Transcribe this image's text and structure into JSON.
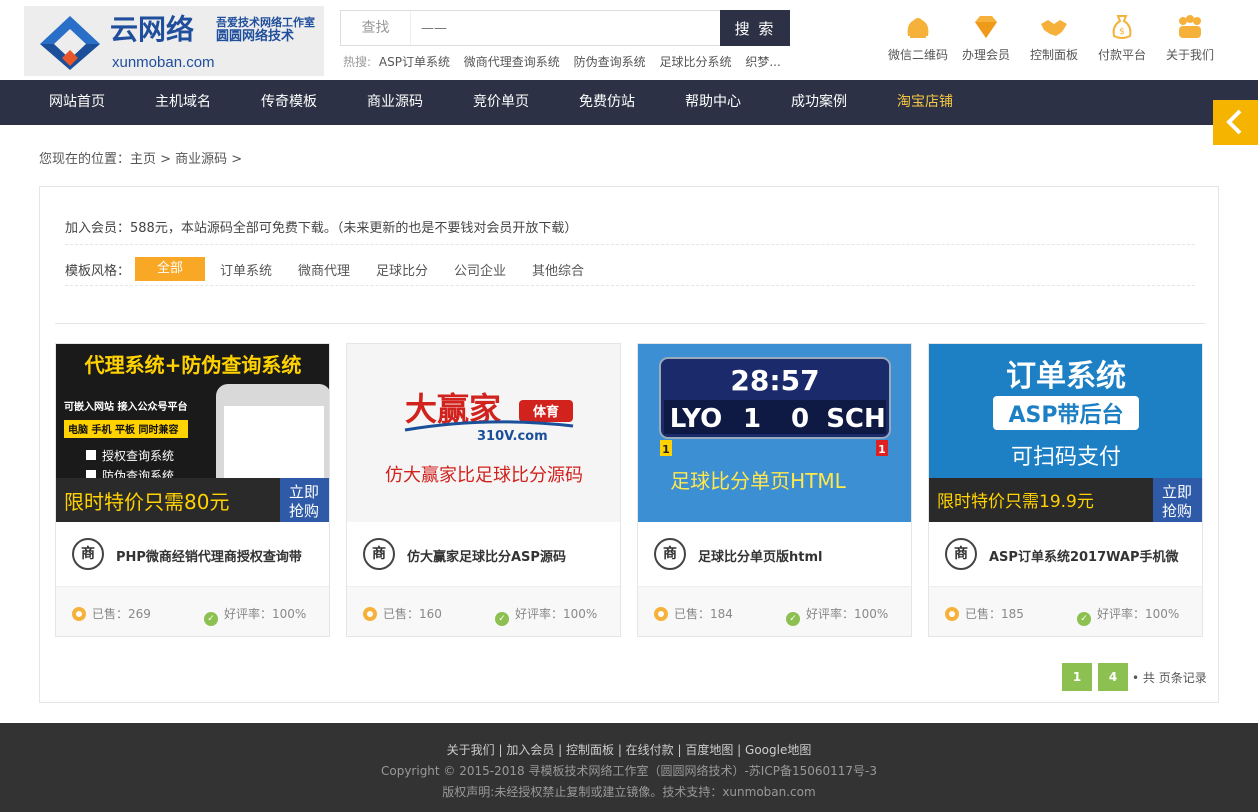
{
  "logo": {
    "title": "云网络",
    "sub1": "吾爱技术网络工作室",
    "sub2": "圆圆网络技术",
    "url": "xunmoban.com"
  },
  "search": {
    "label": "查找",
    "placeholder": "——",
    "button": "搜 索"
  },
  "hot": {
    "label": "热搜:",
    "items": [
      "ASP订单系统",
      "微商代理查询系统",
      "防伪查询系统",
      "足球比分系统",
      "织梦..."
    ]
  },
  "top_icons": [
    {
      "icon": "wechat-qr-icon",
      "label": "微信二维码"
    },
    {
      "icon": "diamond-icon",
      "label": "办理会员"
    },
    {
      "icon": "handshake-icon",
      "label": "控制面板"
    },
    {
      "icon": "money-bag-icon",
      "label": "付款平台"
    },
    {
      "icon": "team-icon",
      "label": "关于我们"
    }
  ],
  "nav": [
    "网站首页",
    "主机域名",
    "传奇模板",
    "商业源码",
    "竞价单页",
    "免费仿站",
    "帮助中心",
    "成功案例",
    "淘宝店铺"
  ],
  "breadcrumb": "您现在的位置：主页 > 商业源码 >",
  "member_notice": "加入会员：588元，本站源码全部可免费下载。（未来更新的也是不要钱对会员开放下载）",
  "filter": {
    "label": "模板风格：",
    "items": [
      "全部",
      "订单系统",
      "微商代理",
      "足球比分",
      "公司企业",
      "其他综合"
    ],
    "active": "全部"
  },
  "products": [
    {
      "title": "PHP微商经销代理商授权查询带",
      "sold": "已售：269",
      "rating": "好评率：100%",
      "thumb": {
        "headline": "代理系统+防伪查询系统",
        "line1": "可嵌入网站  接入公众号平台",
        "line2": "电脑 手机 平板 同时兼容",
        "check1": "授权查询系统",
        "check2": "防伪查询系统",
        "price": "限时特价只需80元",
        "buy1": "立即",
        "buy2": "抢购"
      }
    },
    {
      "title": "仿大赢家足球比分ASP源码",
      "sold": "已售：160",
      "rating": "好评率：100%",
      "thumb": {
        "brand": "大赢家",
        "badge": "体育",
        "domain": "310V.com",
        "caption": "仿大赢家比足球比分源码"
      }
    },
    {
      "title": "足球比分单页版html",
      "sold": "已售：184",
      "rating": "好评率：100%",
      "thumb": {
        "clock": "28:57",
        "home": "LYO",
        "home_score": "1",
        "away_score": "0",
        "away": "SCH",
        "card_left": "1",
        "card_right": "1",
        "caption": "足球比分单页HTML"
      }
    },
    {
      "title": "ASP订单系统2017WAP手机微",
      "sold": "已售：185",
      "rating": "好评率：100%",
      "thumb": {
        "line1": "订单系统",
        "line2": "ASP带后台",
        "line3": "可扫码支付",
        "price": "限时特价只需19.9元",
        "buy1": "立即",
        "buy2": "抢购"
      }
    }
  ],
  "pager": {
    "p1": "1",
    "p2": "4",
    "info": "• 共 页条记录"
  },
  "footer": {
    "links": "关于我们 | 加入会员 | 控制面板 | 在线付款 | 百度地图 | Google地图",
    "copyright": "Copyright © 2015-2018 寻模板技术网络工作室（圆圆网络技术）-苏ICP备15060117号-3",
    "notice": "版权声明:未经授权禁止复制或建立镜像。技术支持：xunmoban.com"
  },
  "colors": {
    "nav_bg": "#2c3145",
    "accent": "#f9a825",
    "green": "#8cc152",
    "footer_bg": "#333333",
    "brand_blue": "#1f4e9c"
  }
}
